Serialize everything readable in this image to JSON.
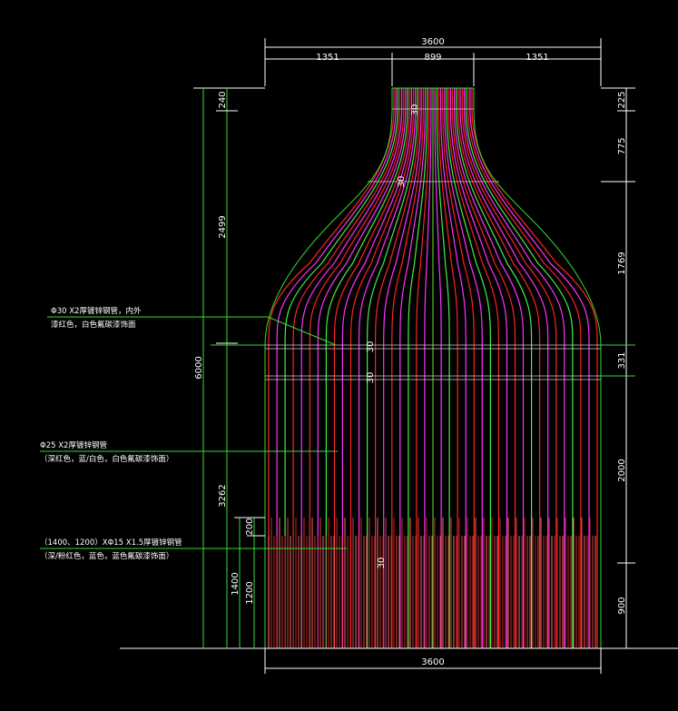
{
  "drawing": {
    "background": "#000000",
    "line_color": "#33dd33",
    "tube_colors": [
      "#ff2222",
      "#ff33ff",
      "#44ee44",
      "#ff2222",
      "#ff33ff"
    ],
    "dimensions": {
      "top_total": "3600",
      "top_left": "1351",
      "top_mid": "899",
      "top_right": "1351",
      "bottom_total": "3600",
      "left_outer_total": "6000",
      "left_a": "240",
      "left_b": "2499",
      "left_c": "3262",
      "left_d": "200",
      "left_e": "1400",
      "left_f": "1200",
      "right_a": "225",
      "right_b": "775",
      "right_c": "1769",
      "right_d": "331",
      "right_e": "2000",
      "right_f": "900"
    },
    "spacing_labels": [
      "30",
      "30",
      "30",
      "30",
      "30"
    ],
    "notes": {
      "note1_line1": "Φ30 X2厚镀锌钢管，内外",
      "note1_line2": "漆红色，白色氟碳漆饰面",
      "note2_line1": "Φ25 X2厚镀锌钢管",
      "note2_line2": "（深红色，蓝/白色，白色氟碳漆饰面）",
      "note3_line1": "（1400、1200）XΦ15 X1.5厚镀锌钢管",
      "note3_line2": "（深/粉红色，蓝色，蓝色氟碳漆饰面）"
    }
  }
}
